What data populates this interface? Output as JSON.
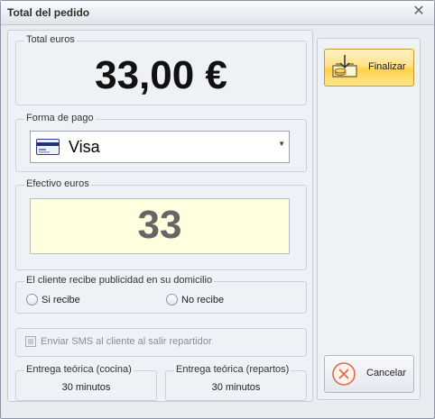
{
  "window": {
    "title": "Total del pedido",
    "close_glyph": "✕"
  },
  "total": {
    "label": "Total euros",
    "value": "33,00 €"
  },
  "payment": {
    "label": "Forma de pago",
    "selected": "Visa",
    "icon": "credit-card-icon",
    "arrow": "▼"
  },
  "cash": {
    "label": "Efectivo euros",
    "value": "33"
  },
  "advertising": {
    "label": "El cliente recibe publicidad en su domicilio",
    "options": [
      {
        "label": "Si recibe",
        "selected": false
      },
      {
        "label": "No recibe",
        "selected": false
      }
    ]
  },
  "sms": {
    "label": "Enviar SMS al cliente al salir repartidor",
    "checked": false,
    "enabled": false
  },
  "delivery": {
    "kitchen": {
      "label": "Entrega teórica (cocina)",
      "value": "30 minutos"
    },
    "delivery": {
      "label": "Entrega teórica (repartos)",
      "value": "30 minutos"
    }
  },
  "actions": {
    "finalize": {
      "label": "Finalizar",
      "icon": "box-download-icon"
    },
    "cancel": {
      "label": "Cancelar",
      "icon": "cancel-circle-icon"
    }
  },
  "colors": {
    "finalize_bg": "#ffd247",
    "cash_bg": "#ffffe0",
    "cancel_icon": "#e06a4a"
  }
}
